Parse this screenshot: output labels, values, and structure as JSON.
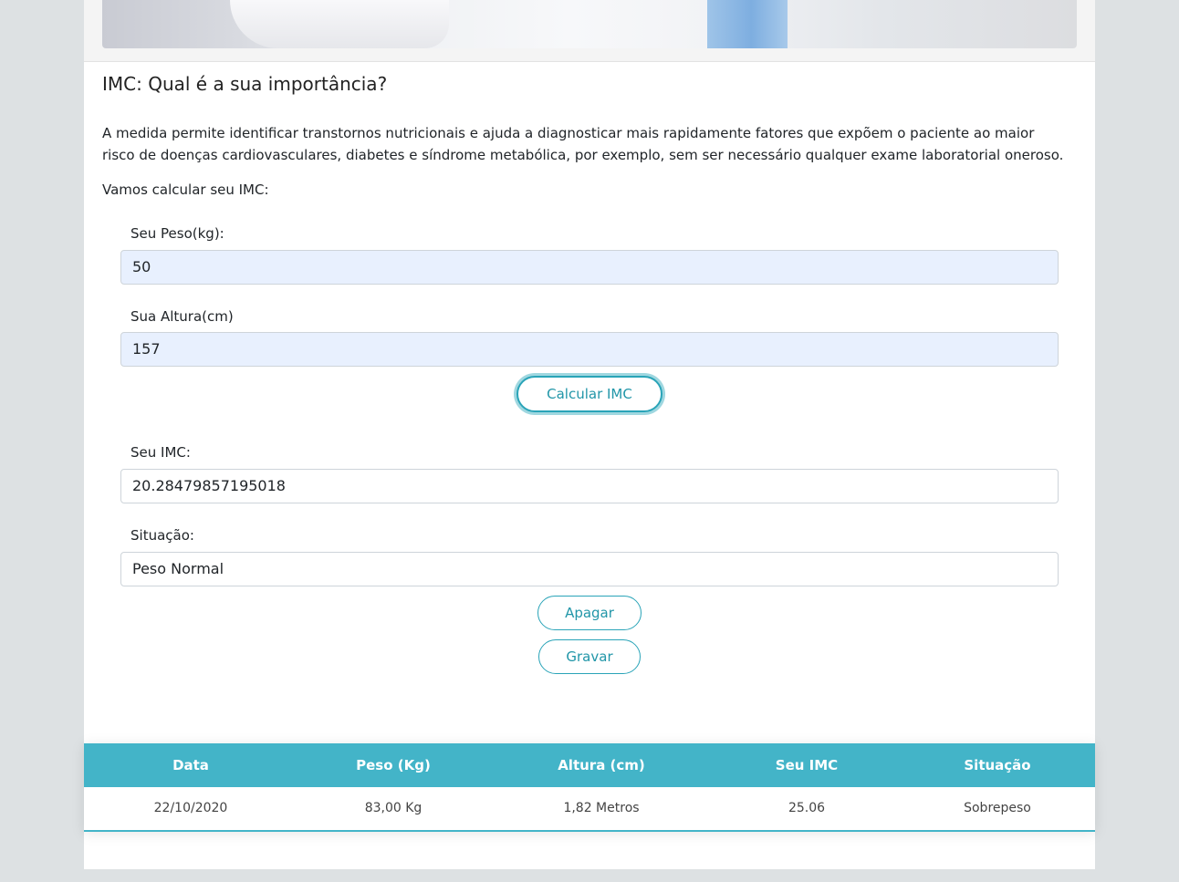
{
  "heading": "IMC: Qual é a sua importância?",
  "intro": "A medida permite identificar transtornos nutricionais e ajuda a diagnosticar mais rapidamente fatores que expõem o paciente ao maior risco de doenças cardiovasculares, diabetes e síndrome metabólica, por exemplo, sem ser necessário qualquer exame laboratorial oneroso.",
  "lead": "Vamos calcular seu IMC:",
  "form": {
    "peso_label": "Seu Peso(kg):",
    "peso_value": "50",
    "altura_label": "Sua Altura(cm)",
    "altura_value": "157",
    "calc_button": "Calcular IMC",
    "imc_label": "Seu IMC:",
    "imc_value": "20.28479857195018",
    "situacao_label": "Situação:",
    "situacao_value": "Peso Normal",
    "apagar_button": "Apagar",
    "gravar_button": "Gravar"
  },
  "table": {
    "headers": [
      "Data",
      "Peso (Kg)",
      "Altura (cm)",
      "Seu IMC",
      "Situação"
    ],
    "rows": [
      [
        "22/10/2020",
        "83,00 Kg",
        "1,82 Metros",
        "25.06",
        "Sobrepeso"
      ]
    ]
  },
  "colors": {
    "accent": "#43b4c8",
    "button": "#2aa4b8",
    "autofill": "#e8f0fe"
  }
}
